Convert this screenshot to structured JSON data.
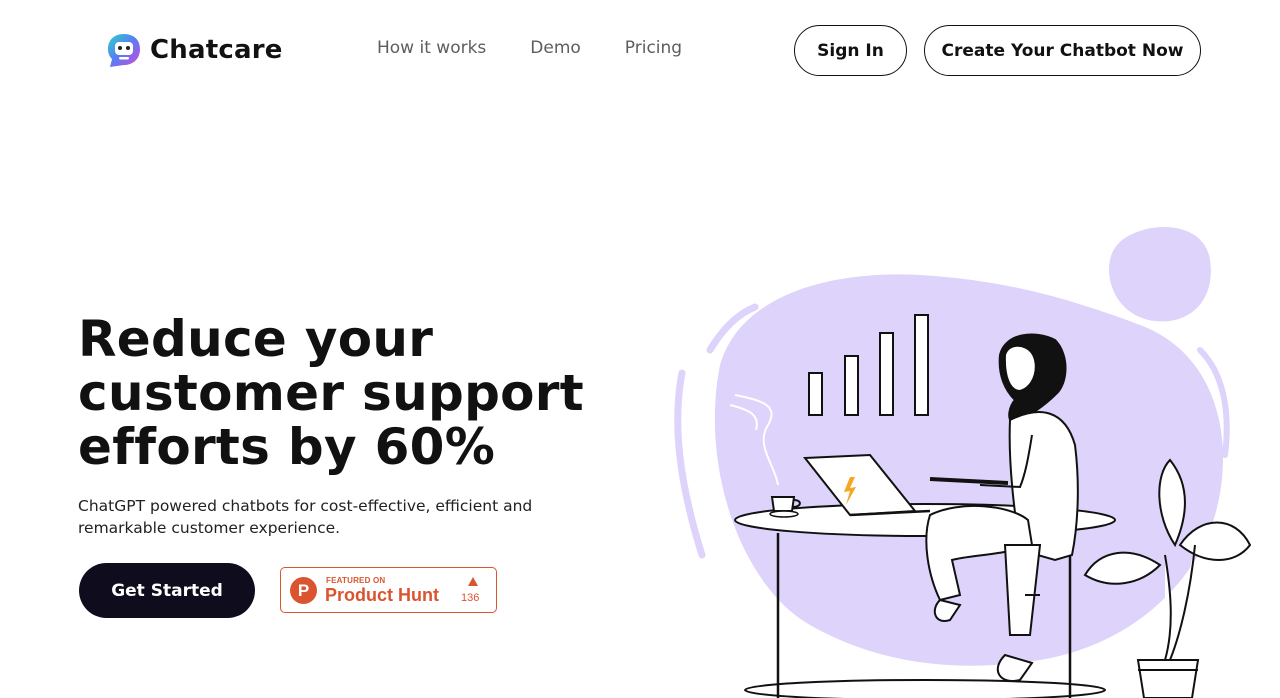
{
  "brand": {
    "name": "Chatcare",
    "logo_icon": "robot-chat-icon"
  },
  "nav": {
    "links": [
      "How it works",
      "Demo",
      "Pricing"
    ],
    "sign_in": "Sign In",
    "create": "Create Your Chatbot Now"
  },
  "hero": {
    "title_lines": [
      "Reduce your",
      "customer support",
      "efforts by 60%"
    ],
    "subtitle": "ChatGPT powered chatbots for cost-effective, efficient and remarkable customer experience.",
    "cta": "Get Started"
  },
  "product_hunt": {
    "featured": "FEATURED ON",
    "name": "Product Hunt",
    "letter": "P",
    "count": "136",
    "color": "#da552f"
  },
  "colors": {
    "accent_purple": "#ddd3fb",
    "dark_button": "#0f0c1d"
  }
}
